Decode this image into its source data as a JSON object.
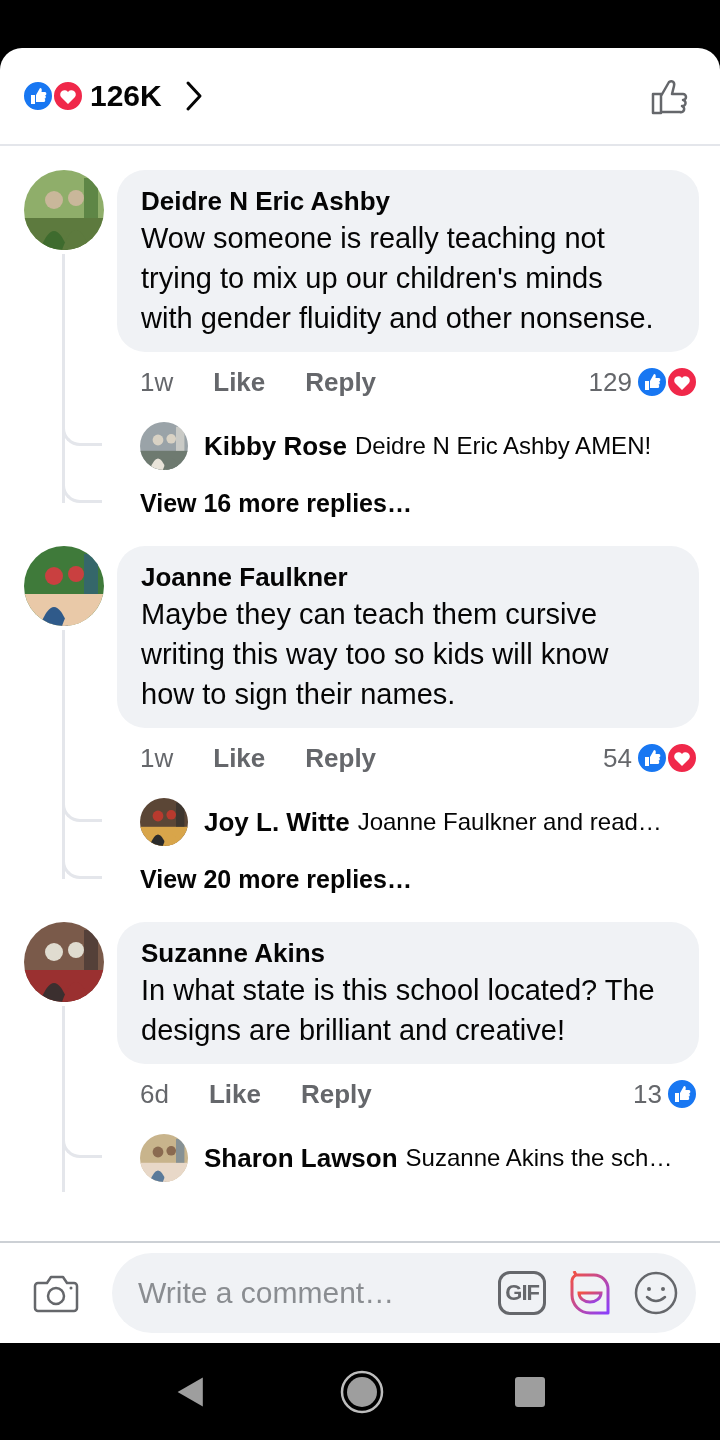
{
  "header": {
    "reactions": [
      {
        "kind": "like"
      },
      {
        "kind": "love"
      }
    ],
    "count": "126K"
  },
  "comments": [
    {
      "author": "Deidre N Eric Ashby",
      "text": "Wow someone is really teaching not trying to mix up our children's minds with gender fluidity and other nonsense.",
      "time": "1w",
      "actions": [
        "Like",
        "Reply"
      ],
      "reaction_count": "129",
      "reactions": [
        {
          "kind": "like"
        },
        {
          "kind": "love"
        }
      ],
      "reply": {
        "author": "Kibby Rose",
        "text": "Deidre N Eric Ashby AMEN!"
      },
      "view_more": "View 16 more replies…"
    },
    {
      "author": "Joanne Faulkner",
      "text": "Maybe they can teach them cursive writing this way too so kids will know how to sign their names.",
      "time": "1w",
      "actions": [
        "Like",
        "Reply"
      ],
      "reaction_count": "54",
      "reactions": [
        {
          "kind": "like"
        },
        {
          "kind": "love"
        }
      ],
      "reply": {
        "author": "Joy L. Witte",
        "text": "Joanne Faulkner and read…"
      },
      "view_more": "View 20 more replies…"
    },
    {
      "author": "Suzanne Akins",
      "text": "In what state is this school located? The designs are brilliant and creative!",
      "time": "6d",
      "actions": [
        "Like",
        "Reply"
      ],
      "reaction_count": "13",
      "reactions": [
        {
          "kind": "like"
        }
      ],
      "reply": {
        "author": "Sharon Lawson",
        "text": "Suzanne Akins the sch…"
      }
    }
  ],
  "composer": {
    "placeholder": "Write a comment…",
    "gif": "GIF"
  }
}
